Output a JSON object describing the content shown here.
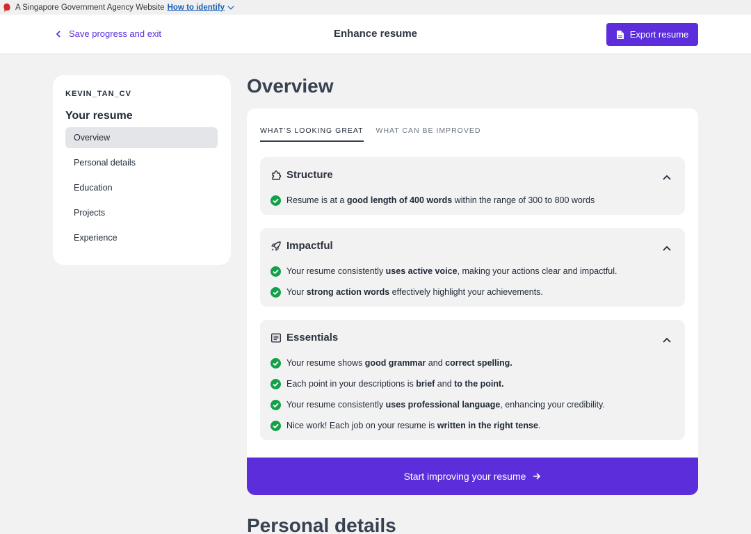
{
  "gov_banner": {
    "text": "A Singapore Government Agency Website",
    "link": "How to identify"
  },
  "header": {
    "back_label": "Save progress and exit",
    "title": "Enhance resume",
    "export_label": "Export resume"
  },
  "sidebar": {
    "file_name": "KEVIN_TAN_CV",
    "heading": "Your resume",
    "items": [
      {
        "label": "Overview",
        "active": true
      },
      {
        "label": "Personal details"
      },
      {
        "label": "Education"
      },
      {
        "label": "Projects"
      },
      {
        "label": "Experience"
      }
    ]
  },
  "main": {
    "heading": "Overview",
    "tabs": [
      {
        "label": "WHAT’S LOOKING GREAT",
        "active": true
      },
      {
        "label": "WHAT CAN BE IMPROVED"
      }
    ],
    "sections": [
      {
        "title": "Structure",
        "icon": "puzzle-icon",
        "items": [
          [
            {
              "t": "Resume is at a "
            },
            {
              "t": "good length of 400 words",
              "b": true
            },
            {
              "t": " within the range of 300 to 800 words"
            }
          ]
        ]
      },
      {
        "title": "Impactful",
        "icon": "rocket-icon",
        "items": [
          [
            {
              "t": "Your resume consistently "
            },
            {
              "t": "uses active voice",
              "b": true
            },
            {
              "t": ", making your actions clear and impactful."
            }
          ],
          [
            {
              "t": "Your "
            },
            {
              "t": "strong action words",
              "b": true
            },
            {
              "t": " effectively highlight your achievements."
            }
          ]
        ]
      },
      {
        "title": "Essentials",
        "icon": "document-icon",
        "items": [
          [
            {
              "t": "Your resume shows "
            },
            {
              "t": "good grammar",
              "b": true
            },
            {
              "t": " and "
            },
            {
              "t": "correct spelling.",
              "b": true
            }
          ],
          [
            {
              "t": "Each point in your descriptions is "
            },
            {
              "t": "brief",
              "b": true
            },
            {
              "t": " and "
            },
            {
              "t": "to the point.",
              "b": true
            }
          ],
          [
            {
              "t": "Your resume consistently "
            },
            {
              "t": "uses professional language",
              "b": true
            },
            {
              "t": ", enhancing your credibility."
            }
          ],
          [
            {
              "t": "Nice work! Each job on your resume is "
            },
            {
              "t": "written in the right tense",
              "b": true
            },
            {
              "t": "."
            }
          ]
        ]
      }
    ],
    "cta_label": "Start improving your resume",
    "next_heading": "Personal details"
  },
  "colors": {
    "accent": "#5b2ddb",
    "check": "#14a04a",
    "page_bg": "#f2f2f3"
  }
}
